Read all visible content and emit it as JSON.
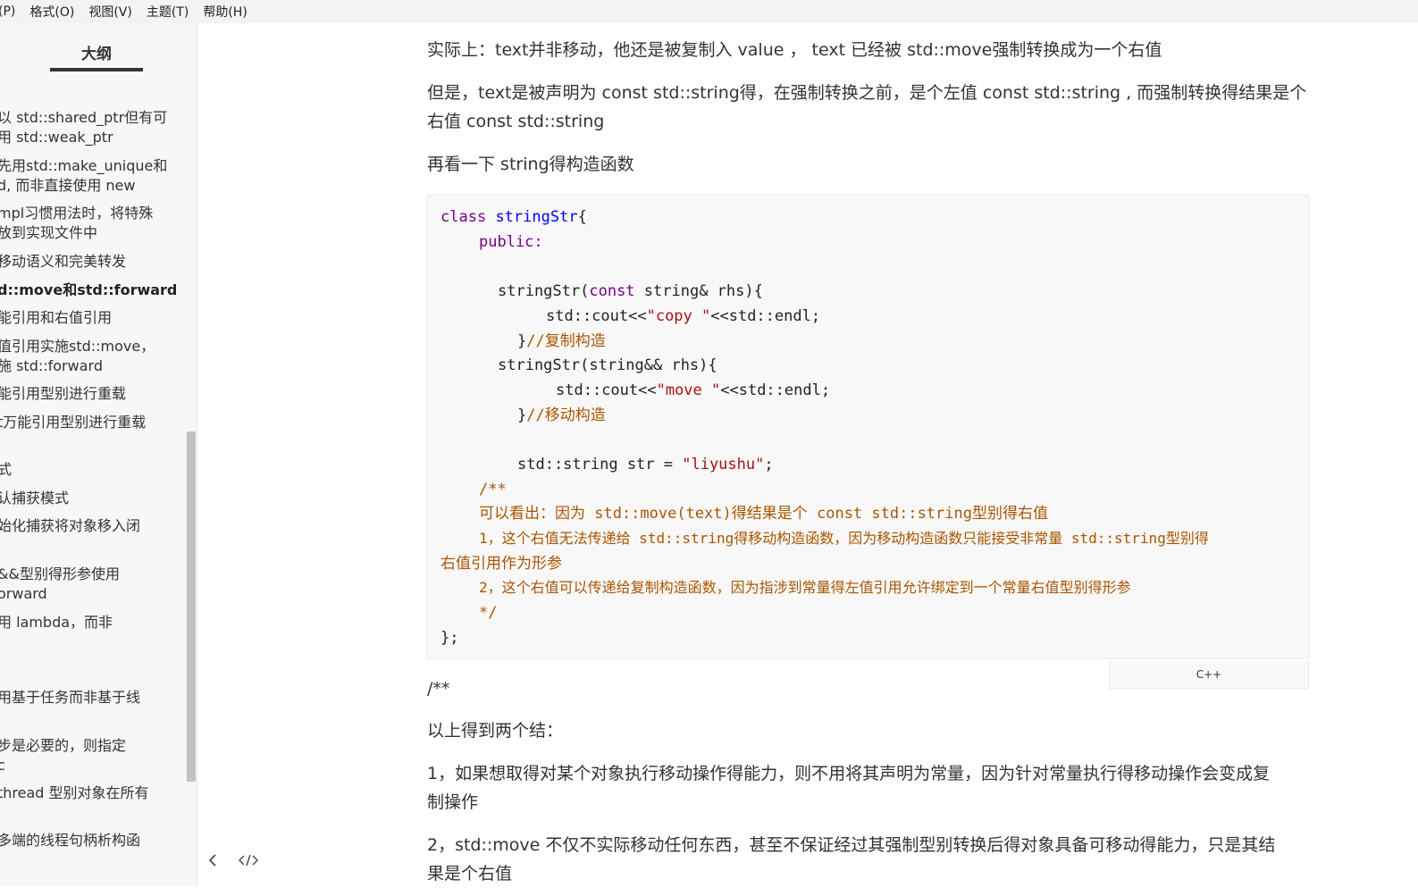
{
  "menu": [
    "(P)",
    "格式(O)",
    "视图(V)",
    "主题(T)",
    "帮助(H)"
  ],
  "sidebar": {
    "title": "大纲",
    "items": [
      {
        "text": "以 std::shared_ptr但有可"
      },
      {
        "text": "用 std::weak_ptr"
      },
      {
        "text": "先用std::make_unique和"
      },
      {
        "text": "d, 而非直接使用 new"
      },
      {
        "text": "mpl习惯用法时，将特殊"
      },
      {
        "text": "放到实现文件中"
      },
      {
        "text": "移动语义和完美转发"
      },
      {
        "text": "d::move和std::forward",
        "active": true
      },
      {
        "text": "能引用和右值引用"
      },
      {
        "text": "值引用实施std::move，"
      },
      {
        "text": "施 std::forward"
      },
      {
        "text": "能引用型别进行重载"
      },
      {
        "text": "t万能引用型别进行重载"
      },
      {
        "text": "式"
      },
      {
        "text": "认捕获模式"
      },
      {
        "text": "始化捕获将对象移入闭"
      },
      {
        "text": "&&型别得形参使用"
      },
      {
        "text": "orward"
      },
      {
        "text": "用 lambda，而非"
      },
      {
        "text": "用基于任务而非基于线"
      },
      {
        "text": "步是必要的，则指定"
      },
      {
        "text": "c"
      },
      {
        "text": "thread 型别对象在所有"
      },
      {
        "text": "多端的线程句柄析构函"
      }
    ],
    "footer_icons": [
      "chevron-left-icon",
      "code-icon"
    ]
  },
  "content": {
    "p1": "实际上：text并非移动，他还是被复制入 value ， text 已经被 std::move强制转换成为一个右值",
    "p2a": "但是，text是被声明为 const std::string得，在强制转换之前，是个左值 const std::string , 而强制转换得结果是个",
    "p2b": "右值 const std::string",
    "p3": "再看一下 string得构造函数",
    "code": {
      "l1_kw": "class",
      "l1_name": "stringStr",
      "l1_rest": "{",
      "l2": "public:",
      "l3a": "stringStr(",
      "l3kw": "const",
      "l3b": " string& rhs){",
      "l4a": "std::cout<<",
      "l4s": "\"copy \"",
      "l4b": "<<std::endl;",
      "l5a": "}",
      "l5c": "//复制构造",
      "l6": "stringStr(string&& rhs){",
      "l7a": "std::cout<<",
      "l7s": "\"move \"",
      "l7b": "<<std::endl;",
      "l8a": "}",
      "l8c": "//移动构造",
      "l9a": "std::string str = ",
      "l9s": "\"liyushu\"",
      "l9b": ";",
      "c1": "/**",
      "c2": "可以看出：因为 std::move(text)得结果是个 const std::string型别得右值",
      "c3": "1，这个右值无法传递给 std::string得移动构造函数，因为移动构造函数只能接受非常量 std::string型别得",
      "c4": "右值引用作为形参",
      "c5": "2，这个右值可以传递给复制构造函数，因为指涉到常量得左值引用允许绑定到一个常量右值型别得形参",
      "c6": "*/",
      "end": "};"
    },
    "lang": "C++",
    "p4": "/**",
    "p5": "以上得到两个结：",
    "p6a": "1，如果想取得对某个对象执行移动操作得能力，则不用将其声明为常量，因为针对常量执行得移动操作会变成复",
    "p6b": "制操作",
    "p7a": "2，std::move 不仅不实际移动任何东西，甚至不保证经过其强制型别转换后得对象具备可移动得能力，只是其结",
    "p7b": "果是个右值"
  }
}
